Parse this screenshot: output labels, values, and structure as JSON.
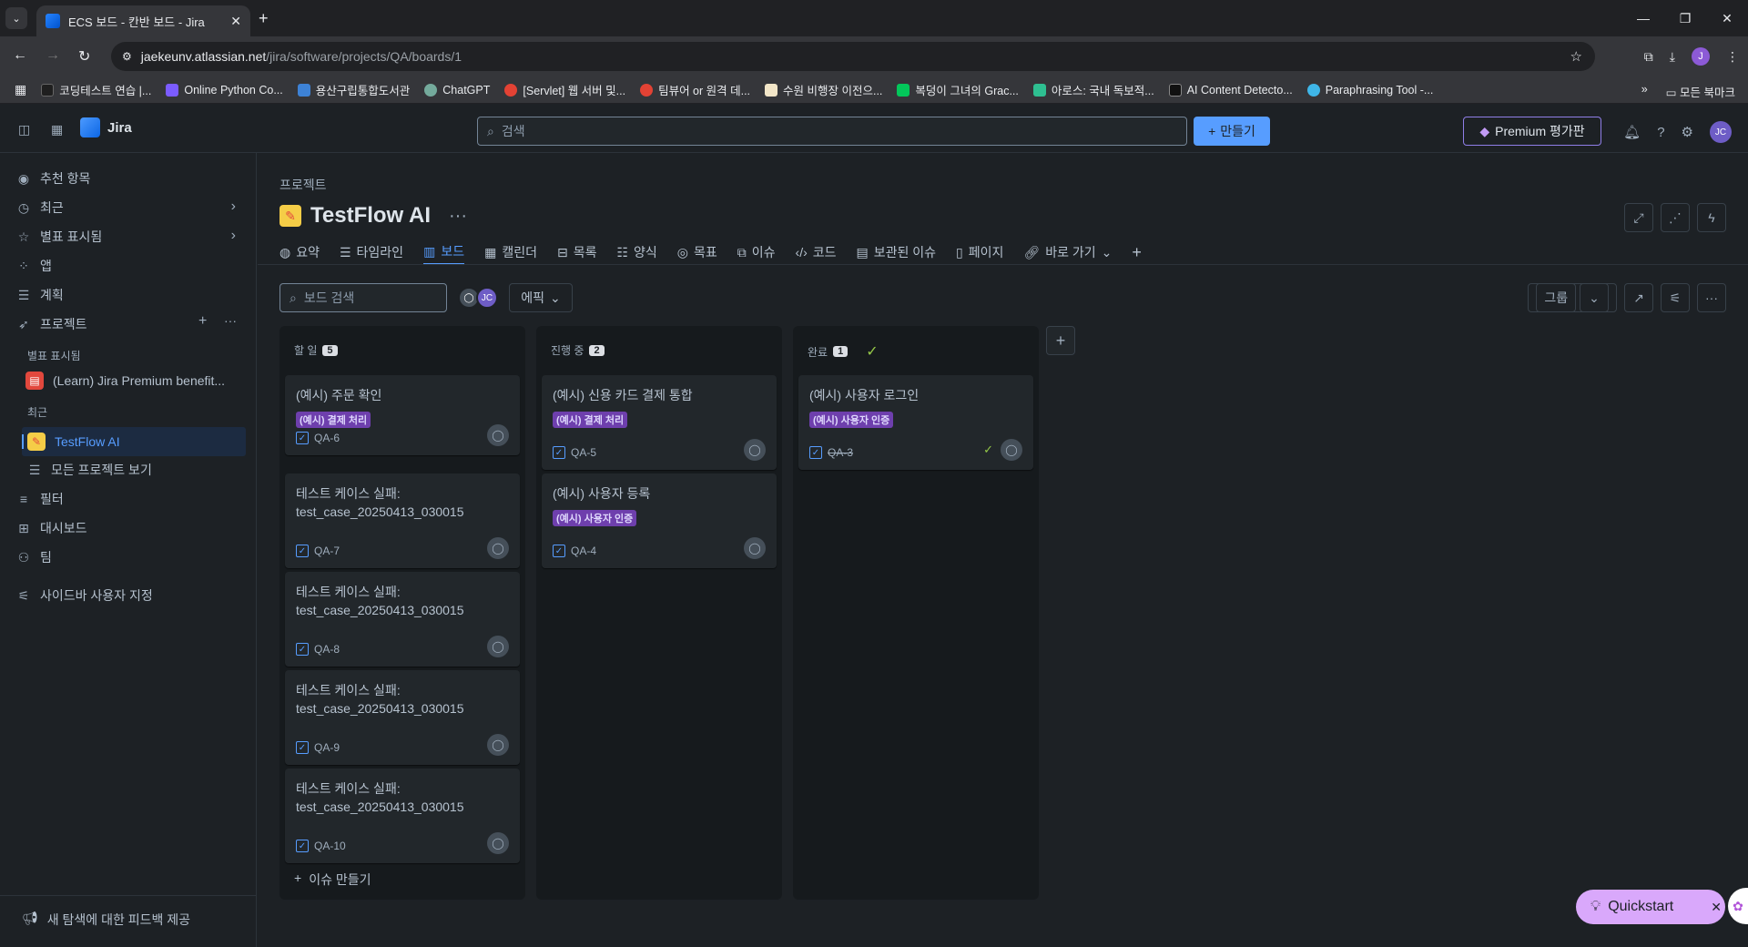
{
  "browser": {
    "tab_title": "ECS 보드 - 칸반 보드 - Jira",
    "url_host": "jaekeunv.atlassian.net",
    "url_path": "/jira/software/projects/QA/boards/1",
    "profile_initial": "J",
    "bookmarks": [
      {
        "label": "코딩테스트 연습 |...",
        "color": "#1f1f1f"
      },
      {
        "label": "Online Python Co...",
        "color": "#7b5cff"
      },
      {
        "label": "용산구립통합도서관",
        "color": "#3d82d6"
      },
      {
        "label": "ChatGPT",
        "color": "#74aa9c"
      },
      {
        "label": "[Servlet] 웹 서버 및...",
        "color": "#e34234"
      },
      {
        "label": "팀뷰어 or 원격 데...",
        "color": "#e34234"
      },
      {
        "label": "수원 비행장 이전으...",
        "color": "#f2e6c8"
      },
      {
        "label": "복덩이 그녀의 Grac...",
        "color": "#03c75a"
      },
      {
        "label": "아로스: 국내 독보적...",
        "color": "#2ebf91"
      },
      {
        "label": "AI Content Detecto...",
        "color": "#111111"
      },
      {
        "label": "Paraphrasing Tool -...",
        "color": "#3fb6e8"
      }
    ],
    "bookmarks_more": "»",
    "all_bookmarks": "모든 북마크"
  },
  "jira": {
    "app_name": "Jira",
    "search_placeholder": "검색",
    "create_label": "만들기",
    "premium_label": "Premium 평가판",
    "avatar_initials": "JC"
  },
  "sidebar": {
    "items": [
      {
        "label": "추천 항목",
        "icon": "person-circle-icon"
      },
      {
        "label": "최근",
        "icon": "clock-icon"
      },
      {
        "label": "별표 표시됨",
        "icon": "star-icon"
      },
      {
        "label": "앱",
        "icon": "apps-icon"
      },
      {
        "label": "계획",
        "icon": "plans-icon"
      },
      {
        "label": "프로젝트",
        "icon": "rocket-icon"
      }
    ],
    "starred_heading": "별표 표시됨",
    "starred_project": "(Learn) Jira Premium benefit...",
    "recent_heading": "최근",
    "recent_project": "TestFlow AI",
    "all_projects": "모든 프로젝트 보기",
    "lower_items": [
      {
        "label": "필터",
        "icon": "filter-icon"
      },
      {
        "label": "대시보드",
        "icon": "dashboard-icon"
      },
      {
        "label": "팀",
        "icon": "team-icon"
      }
    ],
    "customize": "사이드바 사용자 지정",
    "feedback": "새 탐색에 대한 피드백 제공"
  },
  "project": {
    "breadcrumb": "프로젝트",
    "title": "TestFlow AI",
    "tabs": [
      {
        "label": "요약",
        "icon": "globe-icon"
      },
      {
        "label": "타임라인",
        "icon": "timeline-icon"
      },
      {
        "label": "보드",
        "icon": "board-icon",
        "active": true
      },
      {
        "label": "캘린더",
        "icon": "calendar-icon"
      },
      {
        "label": "목록",
        "icon": "list-icon"
      },
      {
        "label": "양식",
        "icon": "form-icon"
      },
      {
        "label": "목표",
        "icon": "target-icon"
      },
      {
        "label": "이슈",
        "icon": "issue-icon"
      },
      {
        "label": "코드",
        "icon": "code-icon"
      },
      {
        "label": "보관된 이슈",
        "icon": "archive-icon"
      },
      {
        "label": "페이지",
        "icon": "page-icon"
      },
      {
        "label": "바로 가기",
        "icon": "link-icon"
      }
    ]
  },
  "board": {
    "search_placeholder": "보드 검색",
    "epic_label": "에픽",
    "group_label": "그룹",
    "create_issue": "이슈 만들기",
    "columns": [
      {
        "title": "할 일",
        "count": "5",
        "cards": [
          {
            "title": "(예시) 주문 확인",
            "epic": "(예시) 결제 처리",
            "key": "QA-6"
          },
          {
            "title": "테스트 케이스 실패: test_case_20250413_030015",
            "epic": "",
            "key": "QA-7"
          },
          {
            "title": "테스트 케이스 실패: test_case_20250413_030015",
            "epic": "",
            "key": "QA-8"
          },
          {
            "title": "테스트 케이스 실패: test_case_20250413_030015",
            "epic": "",
            "key": "QA-9"
          },
          {
            "title": "테스트 케이스 실패: test_case_20250413_030015",
            "epic": "",
            "key": "QA-10"
          }
        ]
      },
      {
        "title": "진행 중",
        "count": "2",
        "cards": [
          {
            "title": "(예시) 신용 카드 결제 통합",
            "epic": "(예시) 결제 처리",
            "key": "QA-5"
          },
          {
            "title": "(예시) 사용자 등록",
            "epic": "(예시) 사용자 인증",
            "key": "QA-4"
          }
        ]
      },
      {
        "title": "완료",
        "count": "1",
        "cards": [
          {
            "title": "(예시) 사용자 로그인",
            "epic": "(예시) 사용자 인증",
            "key": "QA-3",
            "done": true
          }
        ]
      }
    ]
  },
  "quickstart": {
    "label": "Quickstart"
  }
}
